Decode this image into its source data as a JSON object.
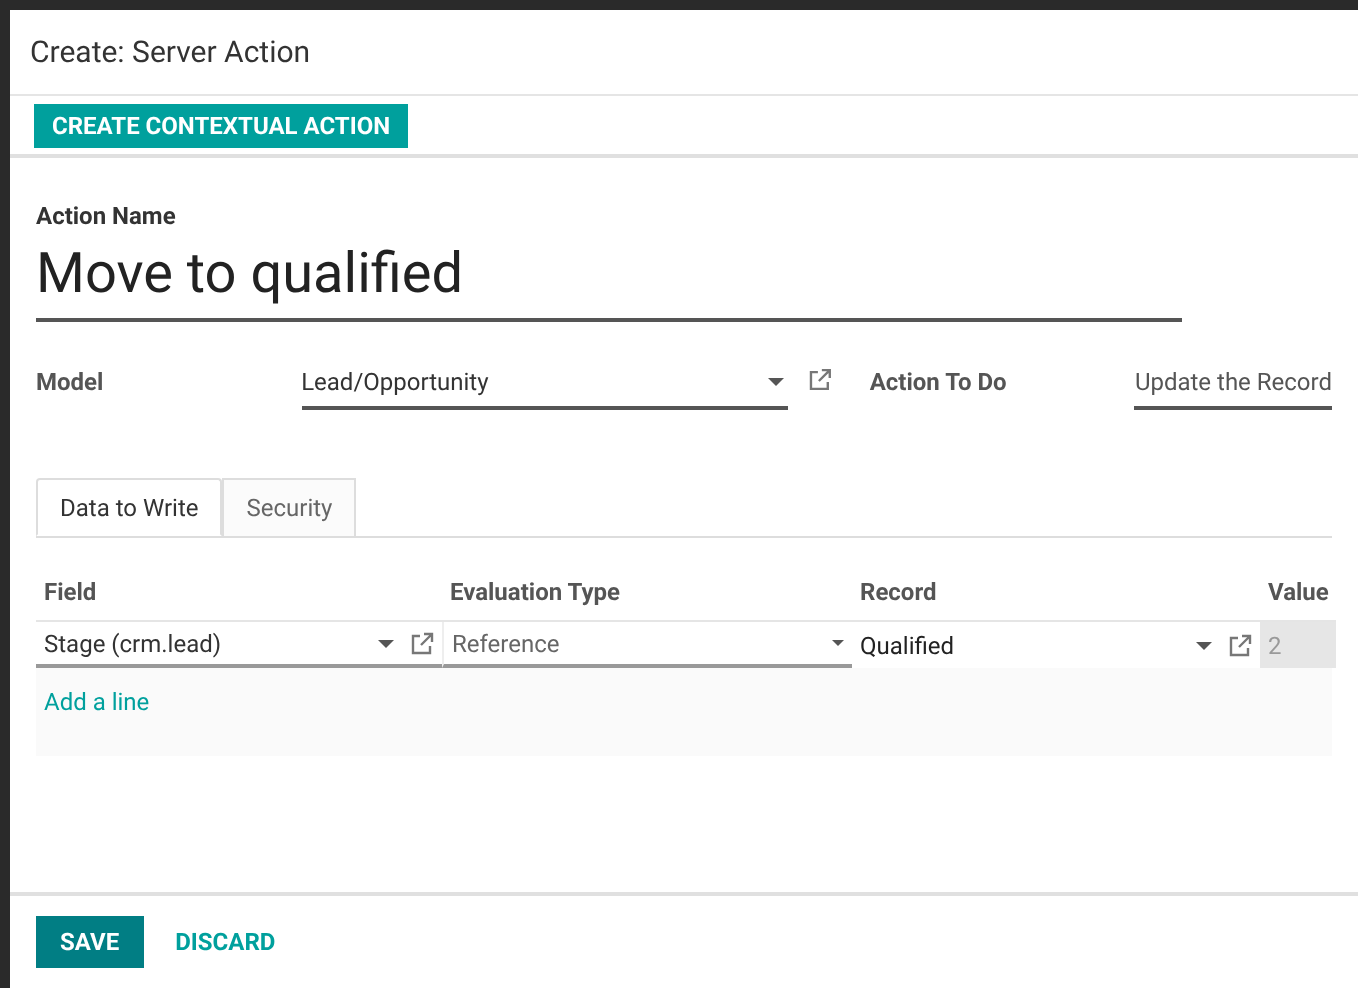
{
  "dialog": {
    "title": "Create: Server Action"
  },
  "toolbar": {
    "button": "CREATE CONTEXTUAL ACTION"
  },
  "form": {
    "name_label": "Action Name",
    "name": "Move to qualified",
    "model_label": "Model",
    "model": "Lead/Opportunity",
    "action_label": "Action To Do",
    "action": "Update the Record"
  },
  "tabs": [
    {
      "label": "Data to Write",
      "selected": true
    },
    {
      "label": "Security",
      "selected": false
    }
  ],
  "table": {
    "columns": [
      "Field",
      "Evaluation Type",
      "Record",
      "Value"
    ],
    "rows": [
      {
        "field": "Stage (crm.lead)",
        "evaluation_type": "Reference",
        "record": "Qualified",
        "value": "2"
      }
    ],
    "add_line": "Add a line"
  },
  "footer": {
    "buttons": [
      "SAVE",
      "DISCARD"
    ]
  }
}
